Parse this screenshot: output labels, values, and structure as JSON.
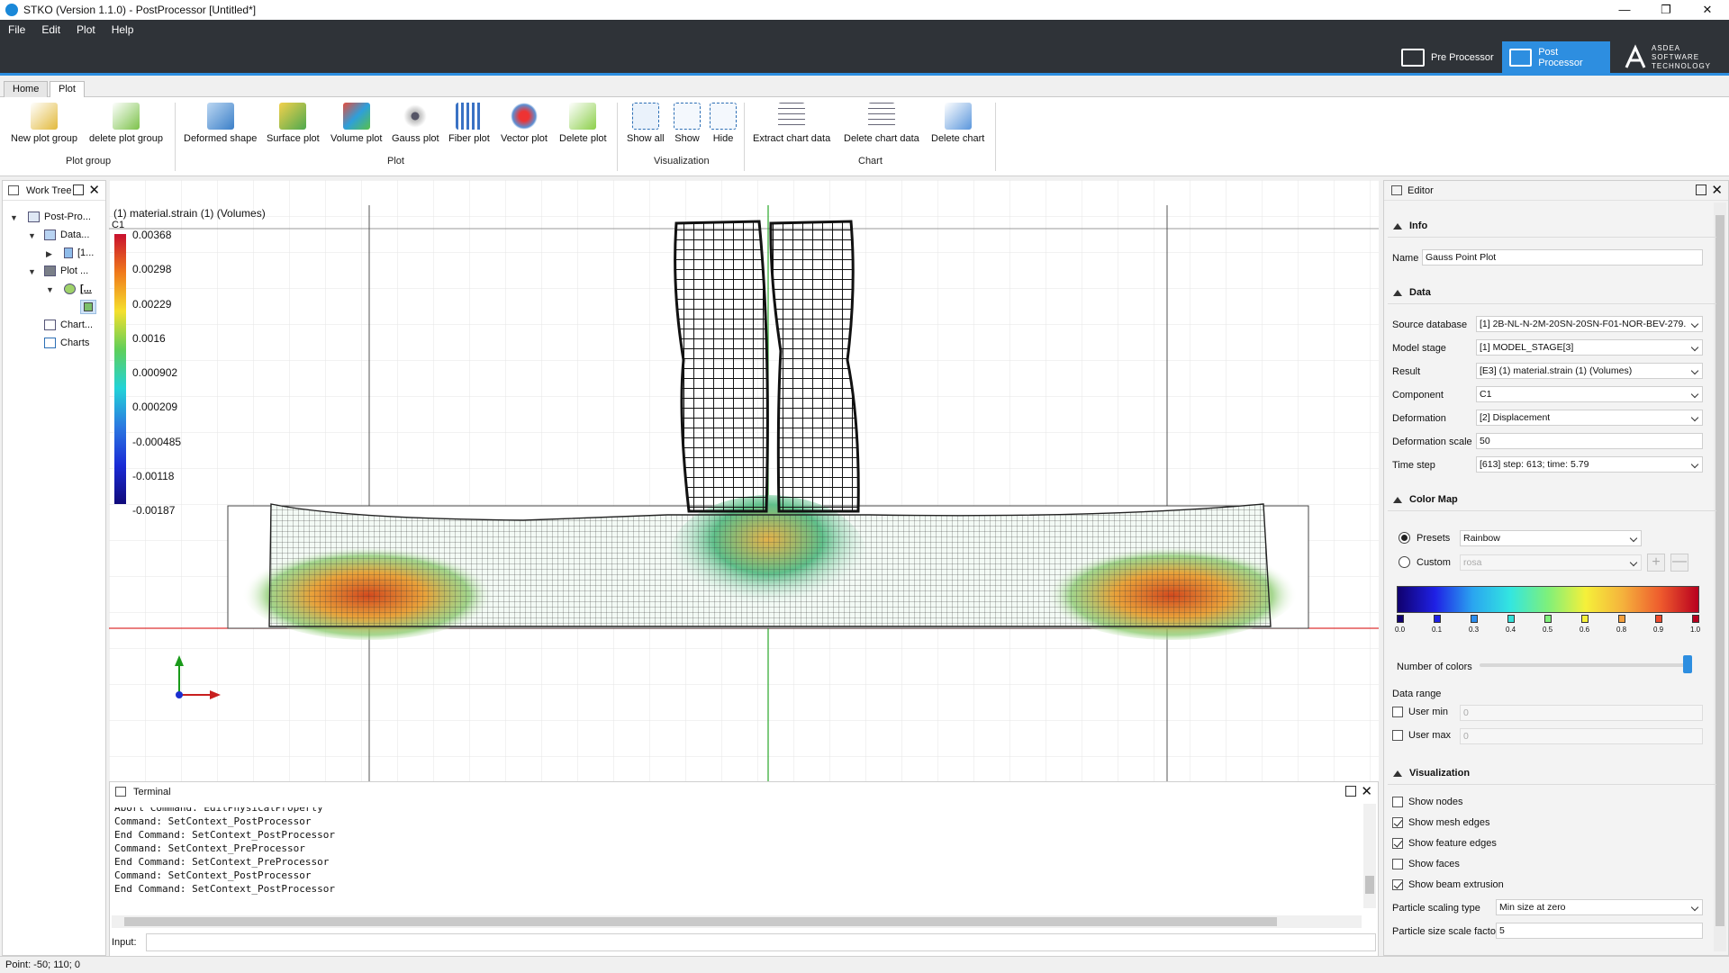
{
  "window": {
    "title": "STKO (Version 1.1.0) - PostProcessor [Untitled*]"
  },
  "menu": [
    "File",
    "Edit",
    "Plot",
    "Help"
  ],
  "modes": {
    "pre": "Pre Processor",
    "post": "Post Processor",
    "brand": "ASDEA SOFTWARE TECHNOLOGY"
  },
  "tabs": [
    "Home",
    "Plot"
  ],
  "ribbon": {
    "plot_group": {
      "label": "Plot group",
      "items": [
        "New plot group",
        "delete plot group"
      ]
    },
    "plot": {
      "label": "Plot",
      "items": [
        "Deformed shape",
        "Surface plot",
        "Volume plot",
        "Gauss plot",
        "Fiber plot",
        "Vector plot",
        "Delete plot"
      ]
    },
    "visualization": {
      "label": "Visualization",
      "items": [
        "Show all",
        "Show",
        "Hide"
      ]
    },
    "chart": {
      "label": "Chart",
      "items": [
        "Extract chart data",
        "Delete chart data",
        "Delete chart"
      ]
    }
  },
  "worktree": {
    "title": "Work Tree",
    "items": [
      "Post-Pro...",
      "Data...",
      "[1...",
      "Plot ...",
      "[...",
      "Chart...",
      "Charts"
    ]
  },
  "viewport": {
    "title": "(1) material.strain (1) (Volumes)",
    "component": "C1",
    "legend": [
      "0.00368",
      "0.00298",
      "0.00229",
      "0.0016",
      "0.000902",
      "0.000209",
      "-0.000485",
      "-0.00118",
      "-0.00187"
    ]
  },
  "terminal": {
    "title": "Terminal",
    "lines": [
      "Abort Command: EditPhysicalProperty",
      "Command: SetContext_PostProcessor",
      "End Command: SetContext_PostProcessor",
      "Command: SetContext_PreProcessor",
      "End Command: SetContext_PreProcessor",
      "Command: SetContext_PostProcessor",
      "End Command: SetContext_PostProcessor"
    ],
    "input_label": "Input:"
  },
  "editor": {
    "title": "Editor",
    "info": {
      "section": "Info",
      "name_label": "Name",
      "name_value": "Gauss Point Plot"
    },
    "data": {
      "section": "Data",
      "rows": [
        {
          "label": "Source database",
          "value": "[1] 2B-NL-N-2M-20SN-20SN-F01-NOR-BEV-279."
        },
        {
          "label": "Model stage",
          "value": "[1] MODEL_STAGE[3]"
        },
        {
          "label": "Result",
          "value": "[E3] (1) material.strain (1) (Volumes)"
        },
        {
          "label": "Component",
          "value": "C1"
        },
        {
          "label": "Deformation",
          "value": "[2] Displacement"
        },
        {
          "label": "Deformation scale",
          "value": "50"
        },
        {
          "label": "Time step",
          "value": "[613] step: 613; time: 5.79"
        }
      ]
    },
    "colormap": {
      "section": "Color Map",
      "presets_label": "Presets",
      "presets_value": "Rainbow",
      "custom_label": "Custom",
      "custom_value": "rosa",
      "ticks": [
        "0.0",
        "0.1",
        "0.3",
        "0.4",
        "0.5",
        "0.6",
        "0.8",
        "0.9",
        "1.0"
      ],
      "num_colors_label": "Number of colors",
      "data_range_label": "Data range",
      "user_min_label": "User min",
      "user_min_value": "0",
      "user_max_label": "User max",
      "user_max_value": "0"
    },
    "visualization": {
      "section": "Visualization",
      "checks": [
        {
          "label": "Show nodes",
          "checked": false
        },
        {
          "label": "Show mesh edges",
          "checked": true
        },
        {
          "label": "Show feature edges",
          "checked": true
        },
        {
          "label": "Show faces",
          "checked": false
        },
        {
          "label": "Show beam extrusion",
          "checked": true
        }
      ],
      "scaling_label": "Particle scaling type",
      "scaling_value": "Min size at zero",
      "size_label": "Particle size scale factor",
      "size_value": "5"
    }
  },
  "status": {
    "point": "Point: -50; 110; 0"
  }
}
